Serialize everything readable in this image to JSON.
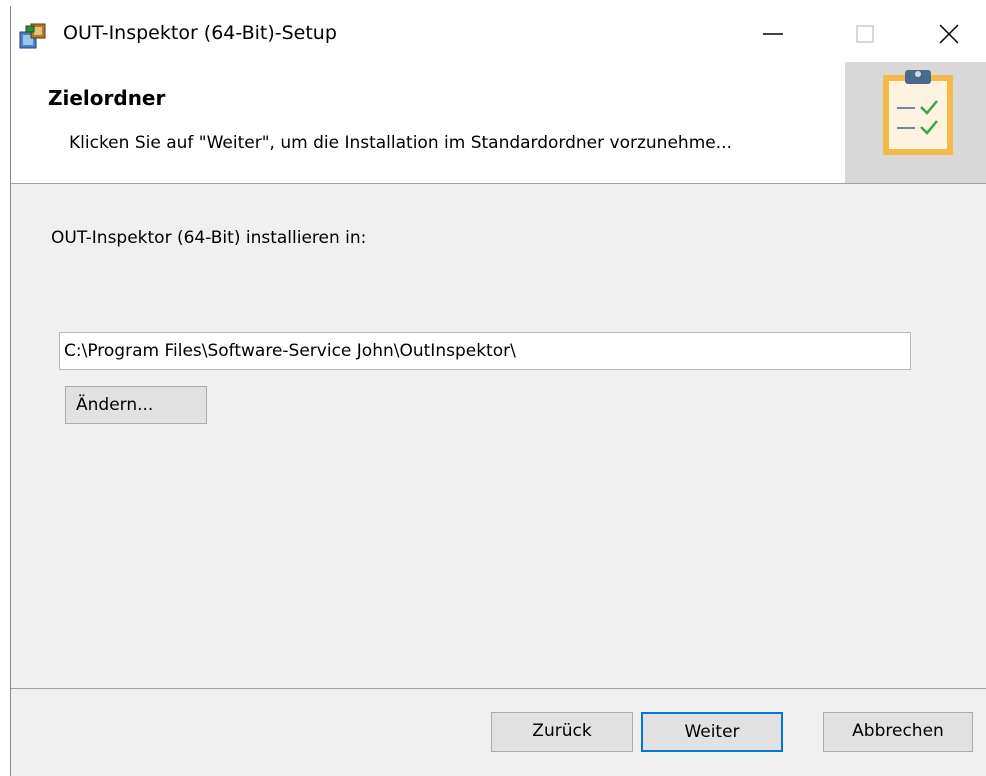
{
  "window": {
    "title": "OUT-Inspektor (64-Bit)-Setup"
  },
  "header": {
    "title": "Zielordner",
    "description": "Klicken Sie auf \"Weiter\", um die Installation im Standardordner vorzunehme..."
  },
  "main": {
    "prompt": "OUT-Inspektor (64-Bit) installieren in:",
    "path_value": "C:\\Program Files\\Software-Service John\\OutInspektor\\",
    "change_label": "Ändern..."
  },
  "footer": {
    "back_label": "Zurück",
    "next_label": "Weiter",
    "cancel_label": "Abbrechen"
  },
  "icons": {
    "app": "installer-package-icon",
    "banner": "clipboard-checklist-icon",
    "minimize": "minimize-icon",
    "maximize": "maximize-icon",
    "close": "close-icon"
  },
  "colors": {
    "accent": "#0078d7",
    "clipboard": "#f5b94a"
  }
}
